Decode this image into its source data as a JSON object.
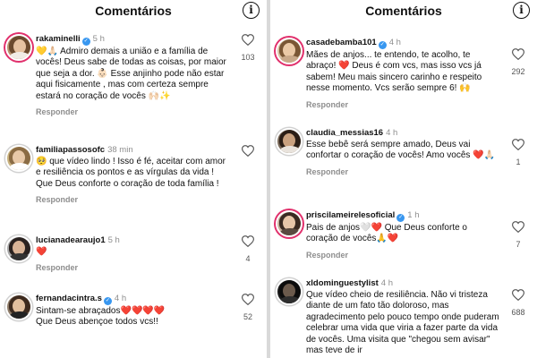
{
  "left_panel": {
    "header": {
      "title": "Comentários",
      "info_icon": "info-icon"
    },
    "comments": [
      {
        "username": "rakaminelli",
        "verified": true,
        "time": "5 h",
        "text": "💛🙏🏻 Admiro demais a união e a família de vocês! Deus sabe de todas as coisas, por maior que seja a dor. 👶🏻 Esse anjinho pode não estar aqui fisicamente , mas com certeza sempre estará no coração de vocês 🙌🏻✨",
        "reply": "Responder",
        "likes": "103"
      },
      {
        "username": "familiapassosofc",
        "verified": false,
        "time": "38 min",
        "text": "🥺 que vídeo lindo ! Isso é fé, aceitar com amor e resiliência os pontos e as vírgulas da vida ! Que Deus conforte o coração de toda família !",
        "reply": "Responder",
        "likes": ""
      },
      {
        "username": "lucianadearaujo1",
        "verified": false,
        "time": "5 h",
        "text": "❤️",
        "reply": "Responder",
        "likes": "4"
      },
      {
        "username": "fernandacintra.s",
        "verified": true,
        "time": "4 h",
        "text": "Sintam-se abraçados❤️❤️❤️❤️\nQue Deus abençoe todos vcs!!",
        "reply": "Responder",
        "likes": "52"
      }
    ]
  },
  "right_panel": {
    "header": {
      "title": "Comentários",
      "info_icon": "info-icon"
    },
    "comments": [
      {
        "username": "casadebamba101",
        "verified": true,
        "time": "4 h",
        "text": "Mães de anjos... te entendo, te acolho, te abraço! ❤️ Deus é com vcs, mas isso vcs já sabem! Meu mais sincero carinho e respeito nesse momento. Vcs serão sempre 6! 🙌",
        "reply": "Responder",
        "likes": "292"
      },
      {
        "username": "claudia_messias16",
        "verified": false,
        "time": "4 h",
        "text": "Esse bebê será sempre amado, Deus vai confortar o coração de vocês! Amo vocês ❤️🙏🏻",
        "reply": "Responder",
        "likes": "1"
      },
      {
        "username": "priscilameirelesoficial",
        "verified": true,
        "time": "1 h",
        "text": "Pais de anjos🤍❤️ Que Deus conforte o coração de vocês🙏❤️",
        "reply": "Responder",
        "likes": "7"
      },
      {
        "username": "xldominguestylist",
        "verified": false,
        "time": "4 h",
        "text": "Que vídeo cheio de resiliência. Não vi tristeza diante de um fato tão doloroso, mas agradecimento pelo pouco tempo onde puderam celebrar uma vida que viria a fazer parte da vida de vocês. Uma visita que \"chegou sem avisar\" mas teve de ir",
        "reply": "",
        "likes": "688"
      }
    ]
  },
  "colors": {
    "verified_badge": "#3897f0",
    "muted_text": "#8e8e8e",
    "story_ring": "#e1306c"
  }
}
